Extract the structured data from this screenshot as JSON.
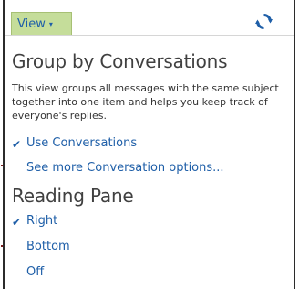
{
  "toolbar": {
    "view_label": "View",
    "caret": "▾"
  },
  "group_section": {
    "title": "Group by Conversations",
    "description": "This view groups all messages with the same subject together into one item and helps you keep track of everyone's replies.",
    "options": [
      {
        "label": "Use Conversations",
        "checked": true
      },
      {
        "label": "See more Conversation options...",
        "checked": false
      }
    ]
  },
  "reading_section": {
    "title": "Reading Pane",
    "options": [
      {
        "label": "Right",
        "checked": true
      },
      {
        "label": "Bottom",
        "checked": false
      },
      {
        "label": "Off",
        "checked": false
      }
    ]
  },
  "glyphs": {
    "check": "✔"
  },
  "colors": {
    "accent": "#1f5fa8",
    "view_button_bg": "#c5dd9a",
    "refresh_blue": "#1f5fa8"
  }
}
